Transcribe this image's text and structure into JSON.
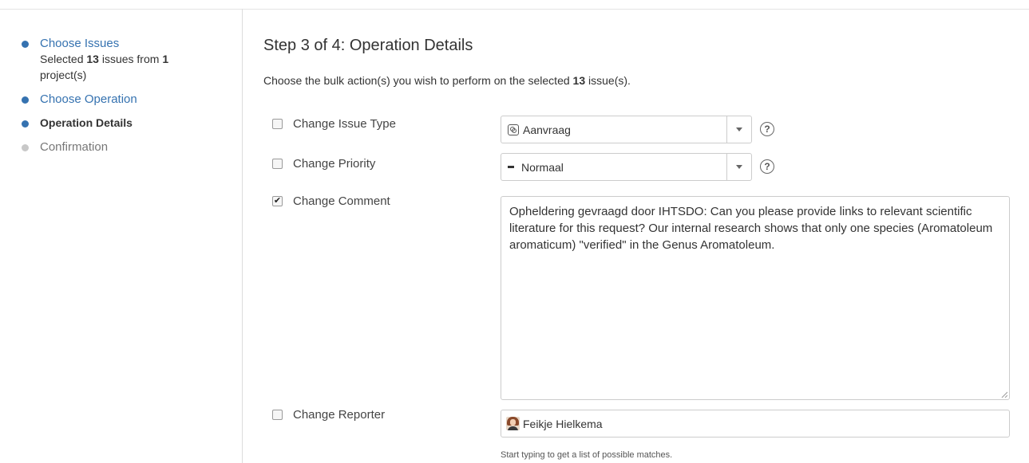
{
  "sidebar": {
    "steps": [
      {
        "label": "Choose Issues",
        "desc_prefix": "Selected ",
        "desc_count": "13",
        "desc_mid": " issues from ",
        "desc_projects": "1",
        "desc_suffix": " project(s)"
      },
      {
        "label": "Choose Operation"
      },
      {
        "label": "Operation Details"
      },
      {
        "label": "Confirmation"
      }
    ]
  },
  "main": {
    "title": "Step 3 of 4: Operation Details",
    "intro_prefix": "Choose the bulk action(s) you wish to perform on the selected ",
    "intro_count": "13",
    "intro_suffix": " issue(s)."
  },
  "fields": {
    "issue_type": {
      "label": "Change Issue Type",
      "checked": false,
      "value": "Aanvraag"
    },
    "priority": {
      "label": "Change Priority",
      "checked": false,
      "value": "Normaal"
    },
    "comment": {
      "label": "Change Comment",
      "checked": true,
      "value": "Opheldering gevraagd door IHTSDO: Can you please provide links to relevant scientific literature for this request? Our internal research shows that only one species (Aromatoleum aromaticum) \"verified\" in the Genus Aromatoleum."
    },
    "reporter": {
      "label": "Change Reporter",
      "checked": false,
      "value": "Feikje Hielkema",
      "hint": "Start typing to get a list of possible matches."
    }
  },
  "help_glyph": "?",
  "check_glyph": "✔",
  "icons": {
    "issue_type": "request-type-icon",
    "priority": "priority-medium-icon",
    "help": "help-icon",
    "reporter": "user-avatar"
  },
  "colors": {
    "link": "#3572b0",
    "pending": "#c8c8c8"
  }
}
